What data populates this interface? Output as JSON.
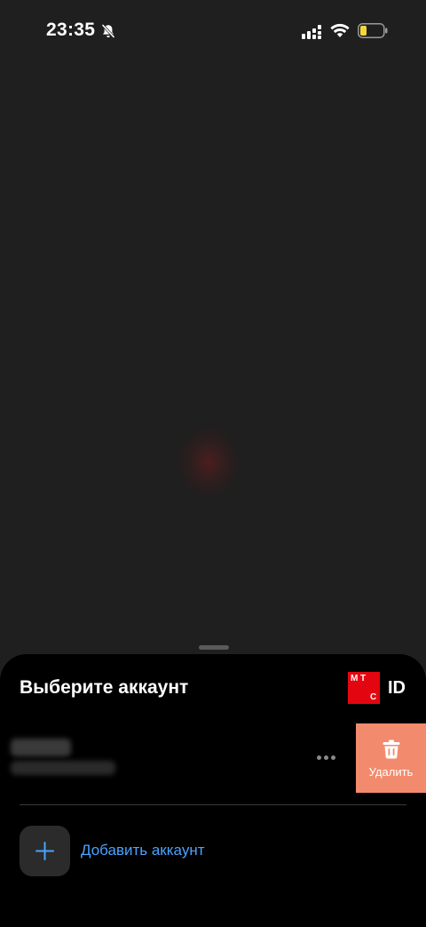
{
  "status_bar": {
    "time": "23:35",
    "icons": [
      "bell-off-icon",
      "signal-icon",
      "wifi-icon",
      "battery-icon"
    ],
    "battery_color": "#f5d63d"
  },
  "sheet": {
    "title": "Выберите аккаунт",
    "brand": {
      "logo_letters": [
        "М",
        "Т",
        "С"
      ],
      "logo_color": "#e30611",
      "id_label": "ID"
    },
    "account": {
      "name": "",
      "phone": "",
      "more_icon": "more-horizontal-icon",
      "delete_label": "Удалить",
      "delete_color": "#f28b6d"
    },
    "add_account_label": "Добавить аккаунт",
    "accent_color": "#4aa3ff"
  }
}
